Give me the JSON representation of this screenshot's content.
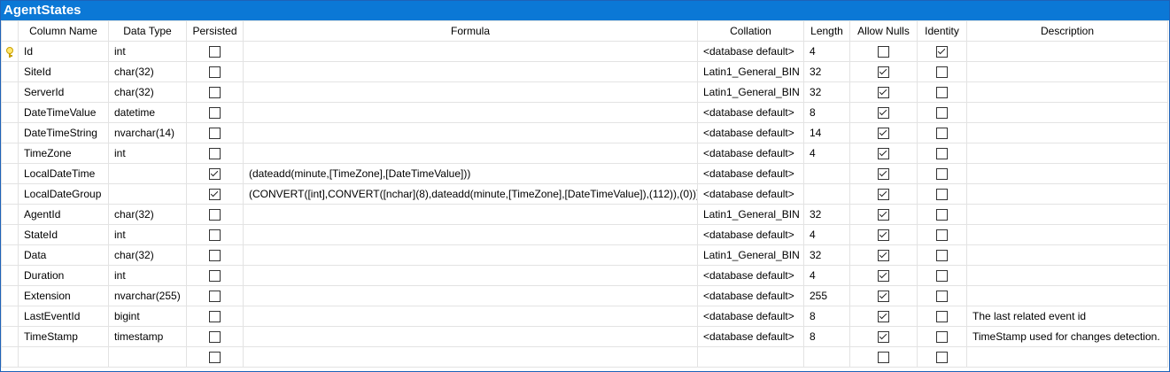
{
  "window": {
    "title": "AgentStates"
  },
  "columns": {
    "name": "Column Name",
    "type": "Data Type",
    "persisted": "Persisted",
    "formula": "Formula",
    "collation": "Collation",
    "length": "Length",
    "nulls": "Allow Nulls",
    "identity": "Identity",
    "description": "Description"
  },
  "rows": [
    {
      "key": true,
      "name": "Id",
      "type": "int",
      "persisted": false,
      "formula": "",
      "collation": "<database default>",
      "length": "4",
      "nulls": false,
      "identity": true,
      "description": ""
    },
    {
      "key": false,
      "name": "SiteId",
      "type": "char(32)",
      "persisted": false,
      "formula": "",
      "collation": "Latin1_General_BIN",
      "length": "32",
      "nulls": true,
      "identity": false,
      "description": ""
    },
    {
      "key": false,
      "name": "ServerId",
      "type": "char(32)",
      "persisted": false,
      "formula": "",
      "collation": "Latin1_General_BIN",
      "length": "32",
      "nulls": true,
      "identity": false,
      "description": ""
    },
    {
      "key": false,
      "name": "DateTimeValue",
      "type": "datetime",
      "persisted": false,
      "formula": "",
      "collation": "<database default>",
      "length": "8",
      "nulls": true,
      "identity": false,
      "description": ""
    },
    {
      "key": false,
      "name": "DateTimeString",
      "type": "nvarchar(14)",
      "persisted": false,
      "formula": "",
      "collation": "<database default>",
      "length": "14",
      "nulls": true,
      "identity": false,
      "description": ""
    },
    {
      "key": false,
      "name": "TimeZone",
      "type": "int",
      "persisted": false,
      "formula": "",
      "collation": "<database default>",
      "length": "4",
      "nulls": true,
      "identity": false,
      "description": ""
    },
    {
      "key": false,
      "name": "LocalDateTime",
      "type": "",
      "persisted": true,
      "formula": "(dateadd(minute,[TimeZone],[DateTimeValue]))",
      "collation": "<database default>",
      "length": "",
      "nulls": true,
      "identity": false,
      "description": ""
    },
    {
      "key": false,
      "name": "LocalDateGroup",
      "type": "",
      "persisted": true,
      "formula": "(CONVERT([int],CONVERT([nchar](8),dateadd(minute,[TimeZone],[DateTimeValue]),(112)),(0)))",
      "collation": "<database default>",
      "length": "",
      "nulls": true,
      "identity": false,
      "description": ""
    },
    {
      "key": false,
      "name": "AgentId",
      "type": "char(32)",
      "persisted": false,
      "formula": "",
      "collation": "Latin1_General_BIN",
      "length": "32",
      "nulls": true,
      "identity": false,
      "description": ""
    },
    {
      "key": false,
      "name": "StateId",
      "type": "int",
      "persisted": false,
      "formula": "",
      "collation": "<database default>",
      "length": "4",
      "nulls": true,
      "identity": false,
      "description": ""
    },
    {
      "key": false,
      "name": "Data",
      "type": "char(32)",
      "persisted": false,
      "formula": "",
      "collation": "Latin1_General_BIN",
      "length": "32",
      "nulls": true,
      "identity": false,
      "description": ""
    },
    {
      "key": false,
      "name": "Duration",
      "type": "int",
      "persisted": false,
      "formula": "",
      "collation": "<database default>",
      "length": "4",
      "nulls": true,
      "identity": false,
      "description": ""
    },
    {
      "key": false,
      "name": "Extension",
      "type": "nvarchar(255)",
      "persisted": false,
      "formula": "",
      "collation": "<database default>",
      "length": "255",
      "nulls": true,
      "identity": false,
      "description": ""
    },
    {
      "key": false,
      "name": "LastEventId",
      "type": "bigint",
      "persisted": false,
      "formula": "",
      "collation": "<database default>",
      "length": "8",
      "nulls": true,
      "identity": false,
      "description": "The last related event id"
    },
    {
      "key": false,
      "name": "TimeStamp",
      "type": "timestamp",
      "persisted": false,
      "formula": "",
      "collation": "<database default>",
      "length": "8",
      "nulls": true,
      "identity": false,
      "description": "TimeStamp used for changes detection."
    },
    {
      "key": false,
      "name": "",
      "type": "",
      "persisted": false,
      "formula": "",
      "collation": "",
      "length": "",
      "nulls": false,
      "identity": false,
      "description": "",
      "empty": true
    }
  ]
}
